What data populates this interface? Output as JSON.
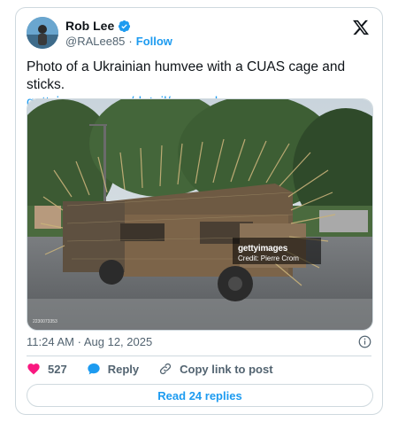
{
  "author": {
    "name": "Rob Lee",
    "handle": "@RALee85",
    "separator": "·",
    "follow_label": "Follow"
  },
  "tweet": {
    "text": "Photo of a Ukrainian humvee with a CUAS cage and sticks.",
    "link": "gettyimages.com/detail/news-ph…"
  },
  "media": {
    "watermark_brand": "gettyimages",
    "credit": "Credit: Pierre Crom",
    "image_id": "2230073353"
  },
  "meta": {
    "time": "11:24 AM",
    "separator": "·",
    "date": "Aug 12, 2025"
  },
  "actions": {
    "likes": "527",
    "reply_label": "Reply",
    "copy_label": "Copy link to post"
  },
  "read_replies_label": "Read 24 replies",
  "colors": {
    "accent": "#1d9bf0",
    "like": "#f91880",
    "muted": "#536471",
    "border": "#cfd9de"
  },
  "icons": [
    "verified-badge-icon",
    "x-logo-icon",
    "info-icon",
    "heart-icon",
    "reply-bubble-icon",
    "link-icon"
  ]
}
